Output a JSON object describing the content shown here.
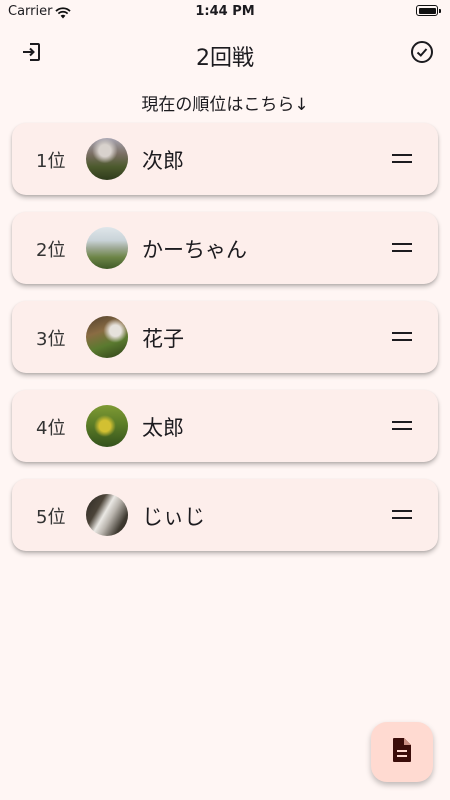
{
  "status_bar": {
    "carrier": "Carrier",
    "time": "1:44 PM"
  },
  "app_bar": {
    "title": "2回戦",
    "left_icon": "exit-icon",
    "right_icon": "check-circle-icon"
  },
  "subtitle": "現在の順位はこちら↓",
  "ranking": [
    {
      "rank": "1位",
      "name": "次郎"
    },
    {
      "rank": "2位",
      "name": "かーちゃん"
    },
    {
      "rank": "3位",
      "name": "花子"
    },
    {
      "rank": "4位",
      "name": "太郎"
    },
    {
      "rank": "5位",
      "name": "じぃじ"
    }
  ],
  "fab": {
    "icon": "document-icon"
  },
  "colors": {
    "background": "#fff6f4",
    "card": "#fdeeeb",
    "fab": "#ffdad1",
    "text": "#1c1b1f"
  }
}
